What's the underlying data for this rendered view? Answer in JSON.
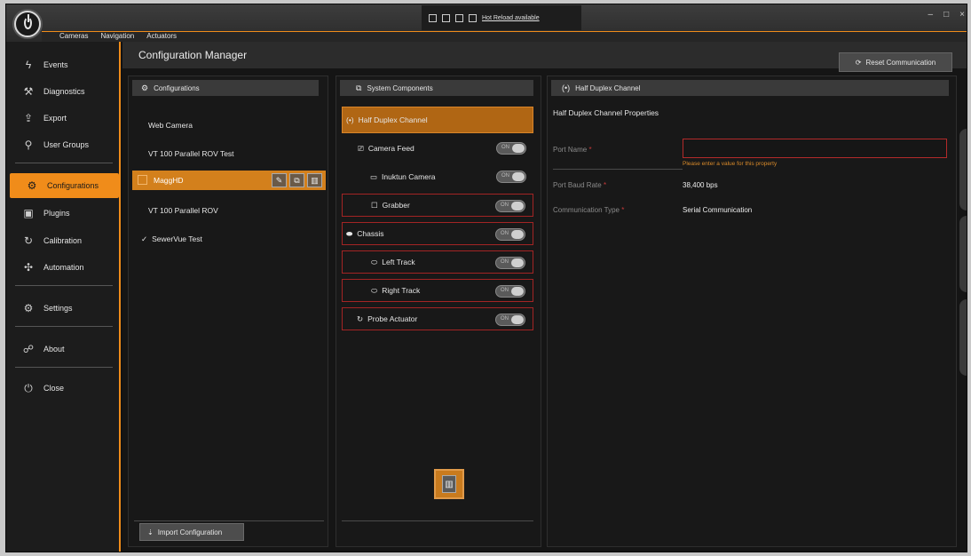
{
  "titlebar": {
    "menu_tabs": [
      "Cameras",
      "Navigation",
      "Actuators"
    ],
    "hot_reload": "Hot Reload available",
    "controls": {
      "minimize": "–",
      "maximize": "□",
      "close": "×"
    }
  },
  "sidebar": {
    "items": [
      {
        "label": "Events",
        "icon": "bolt-icon"
      },
      {
        "label": "Diagnostics",
        "icon": "wrench-icon"
      },
      {
        "label": "Export",
        "icon": "export-icon"
      },
      {
        "label": "User Groups",
        "icon": "user-search-icon"
      },
      {
        "label": "Configurations",
        "icon": "config-icon"
      },
      {
        "label": "Plugins",
        "icon": "plugin-icon"
      },
      {
        "label": "Calibration",
        "icon": "calibration-icon"
      },
      {
        "label": "Automation",
        "icon": "automation-icon"
      },
      {
        "label": "Settings",
        "icon": "gear-icon"
      },
      {
        "label": "About",
        "icon": "about-icon"
      },
      {
        "label": "Close",
        "icon": "power-icon"
      }
    ]
  },
  "header": {
    "title": "Configuration Manager",
    "reset_label": "Reset Communication"
  },
  "configurations": {
    "title": "Configurations",
    "items": [
      "Web Camera",
      "VT 100 Parallel ROV Test",
      "MaggHD",
      "VT 100 Parallel ROV",
      "SewerVue Test"
    ],
    "import_label": "Import Configuration"
  },
  "components": {
    "title": "System Components",
    "items": [
      {
        "label": "Half Duplex Channel",
        "toggle": ""
      },
      {
        "label": "Camera Feed",
        "toggle": "ON"
      },
      {
        "label": "Inuktun Camera",
        "toggle": "ON"
      },
      {
        "label": "Grabber",
        "toggle": "ON"
      },
      {
        "label": "Chassis",
        "toggle": "ON"
      },
      {
        "label": "Left Track",
        "toggle": "ON"
      },
      {
        "label": "Right Track",
        "toggle": "ON"
      },
      {
        "label": "Probe Actuator",
        "toggle": "ON"
      }
    ]
  },
  "properties": {
    "title": "Half Duplex Channel",
    "subtitle": "Half Duplex Channel Properties",
    "port_name_label": "Port Name",
    "port_name_value": "",
    "port_name_error": "Please enter a value for this property",
    "baud_label": "Port Baud Rate",
    "baud_value": "38,400 bps",
    "comm_label": "Communication Type",
    "comm_value": "Serial Communication",
    "required_mark": "*"
  },
  "colors": {
    "accent": "#f08c1a",
    "error": "#b32a2a"
  }
}
